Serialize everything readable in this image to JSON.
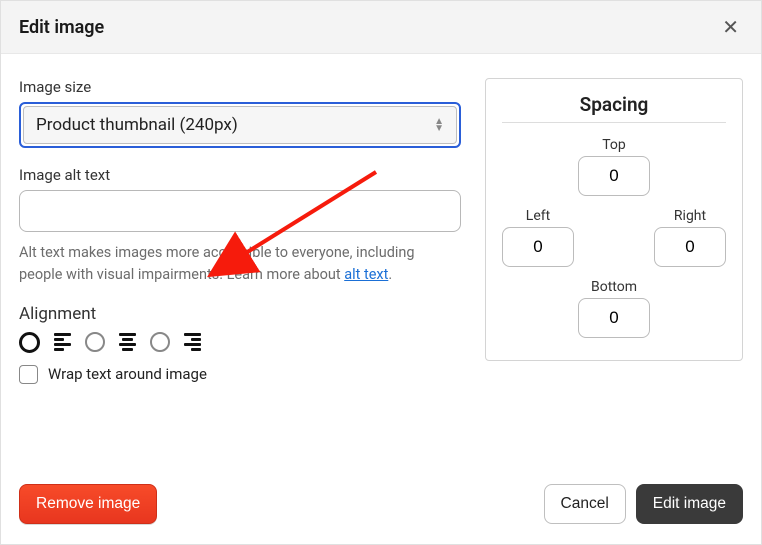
{
  "header": {
    "title": "Edit image"
  },
  "imageSize": {
    "label": "Image size",
    "selected": "Product thumbnail (240px)"
  },
  "altText": {
    "label": "Image alt text",
    "value": "",
    "help_prefix": "Alt text makes images more accessible to everyone, including people with visual impairments. Learn more about ",
    "help_link": "alt text",
    "help_suffix": "."
  },
  "alignment": {
    "label": "Alignment",
    "wrap_label": "Wrap text around image"
  },
  "spacing": {
    "title": "Spacing",
    "top_label": "Top",
    "left_label": "Left",
    "right_label": "Right",
    "bottom_label": "Bottom",
    "top": "0",
    "left": "0",
    "right": "0",
    "bottom": "0"
  },
  "footer": {
    "remove": "Remove image",
    "cancel": "Cancel",
    "submit": "Edit image"
  }
}
